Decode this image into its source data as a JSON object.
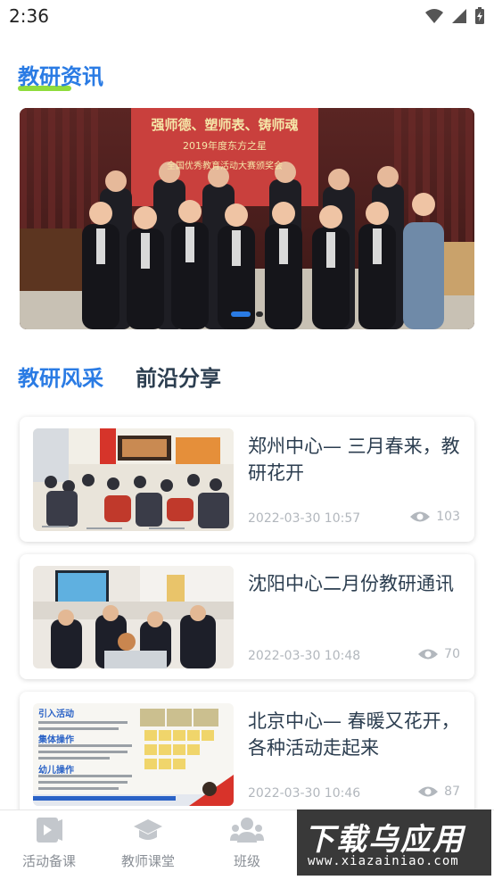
{
  "status_bar": {
    "time": "2:36"
  },
  "section": {
    "title": "教研资讯"
  },
  "banner": {
    "headline": "强师德、塑师表、铸师魂",
    "subline": "2019年度东方之星",
    "subline2": "全国优秀教育活动大赛颁奖会",
    "active_dot": 1,
    "dot_count": 2
  },
  "tabs": [
    {
      "label": "教研风采",
      "active": true
    },
    {
      "label": "前沿分享",
      "active": false
    }
  ],
  "cards": [
    {
      "title": "郑州中心— 三月春来，教研花开",
      "date": "2022-03-30 10:57",
      "views": "103"
    },
    {
      "title": "沈阳中心二月份教研通讯",
      "date": "2022-03-30 10:48",
      "views": "70"
    },
    {
      "title": "北京中心— 春暖又花开，各种活动走起来",
      "date": "2022-03-30 10:46",
      "views": "87"
    }
  ],
  "card3_thumb": {
    "heading1": "引入活动",
    "heading2": "集体操作",
    "heading3": "幼儿操作"
  },
  "bottom_nav": [
    {
      "label": "活动备课",
      "icon": "book-play-icon"
    },
    {
      "label": "教师课堂",
      "icon": "graduation-cap-icon"
    },
    {
      "label": "班级",
      "icon": "group-icon"
    }
  ],
  "watermark": {
    "main": "下载乌应用",
    "sub": "www.xiazainiao.com"
  },
  "colors": {
    "accent": "#2a7be4",
    "underline": "#8fdc3c",
    "muted": "#b2b7bd"
  }
}
